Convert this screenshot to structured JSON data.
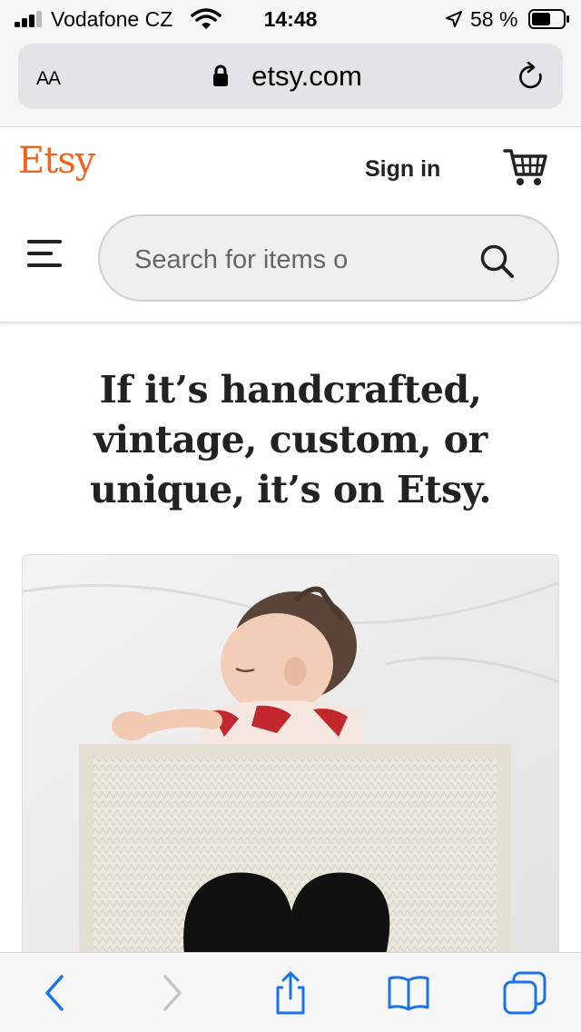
{
  "status_bar": {
    "carrier": "Vodafone CZ",
    "time": "14:48",
    "battery": "58 %"
  },
  "browser": {
    "text_size": "AA",
    "url": "etsy.com"
  },
  "header": {
    "logo": "Etsy",
    "sign_in": "Sign in",
    "search_placeholder": "Search for items o"
  },
  "hero": {
    "heading": "If it’s handcrafted, vintage, custom, or unique, it’s on Etsy."
  },
  "colors": {
    "brand_orange": "#f1641e",
    "ios_blue": "#1a73e8"
  },
  "icons": {
    "status": [
      "signal-icon",
      "wifi-icon",
      "location-icon",
      "battery-icon"
    ],
    "browser": [
      "lock-icon",
      "reload-icon"
    ],
    "header": [
      "cart-icon",
      "menu-icon",
      "search-icon"
    ],
    "toolbar": [
      "back-icon",
      "forward-icon",
      "share-icon",
      "bookmarks-icon",
      "tabs-icon"
    ]
  }
}
